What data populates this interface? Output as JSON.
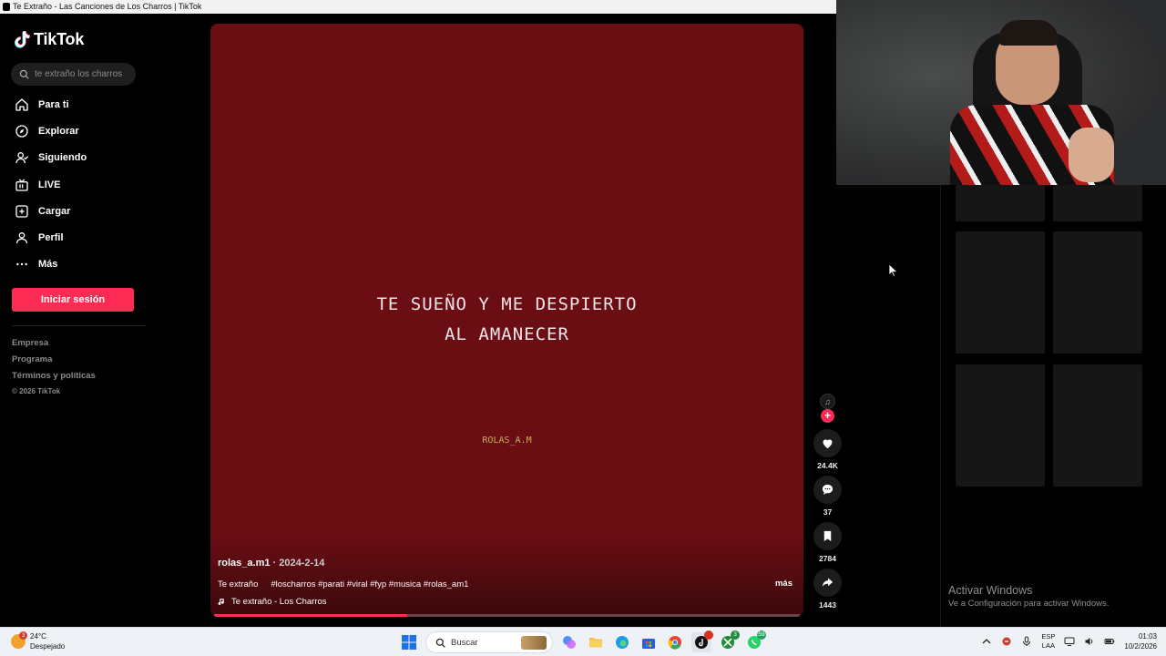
{
  "window": {
    "title": "Te Extraño - Las Canciones de Los Charros | TikTok"
  },
  "sidebar": {
    "logo_text": "TikTok",
    "search_placeholder": "te extraño los charros",
    "nav": [
      {
        "label": "Para ti",
        "icon": "home-icon"
      },
      {
        "label": "Explorar",
        "icon": "compass-icon"
      },
      {
        "label": "Siguiendo",
        "icon": "following-icon"
      },
      {
        "label": "LIVE",
        "icon": "live-icon"
      },
      {
        "label": "Cargar",
        "icon": "upload-icon"
      },
      {
        "label": "Perfil",
        "icon": "profile-icon"
      },
      {
        "label": "Más",
        "icon": "more-icon"
      }
    ],
    "login_label": "Iniciar sesión",
    "footer": {
      "empresa": "Empresa",
      "programa": "Programa",
      "terminos": "Términos y políticas",
      "copyright": "© 2026 TikTok"
    }
  },
  "video": {
    "lyrics_line1": "TE SUEÑO Y ME DESPIERTO",
    "lyrics_line2": "AL AMANECER",
    "watermark": "ROLAS_A.M",
    "username": "rolas_a.m1",
    "date": " · 2024-2-14",
    "caption": "Te extraño",
    "hashtags": "#loscharros #parati #viral #fyp #musica #rolas_am1",
    "more_label": "más",
    "sound": "Te extraño - Los Charros",
    "progress": 0.33,
    "accent": "#fe2c55",
    "background": "#6a0e14"
  },
  "actions": {
    "likes": "24.4K",
    "comments": "37",
    "saves": "2784",
    "shares": "1443"
  },
  "windows_watermark": {
    "title": "Activar Windows",
    "subtitle": "Ve a Configuración para activar Windows."
  },
  "taskbar": {
    "weather_temp": "24°C",
    "weather_desc": "Despejado",
    "weather_badge": "3",
    "search_label": "Buscar",
    "xbox_badge": "3",
    "whatsapp_badge": "59",
    "lang_top": "ESP",
    "lang_bottom": "LAA",
    "time": "01:03",
    "date": "10/2/2026"
  }
}
